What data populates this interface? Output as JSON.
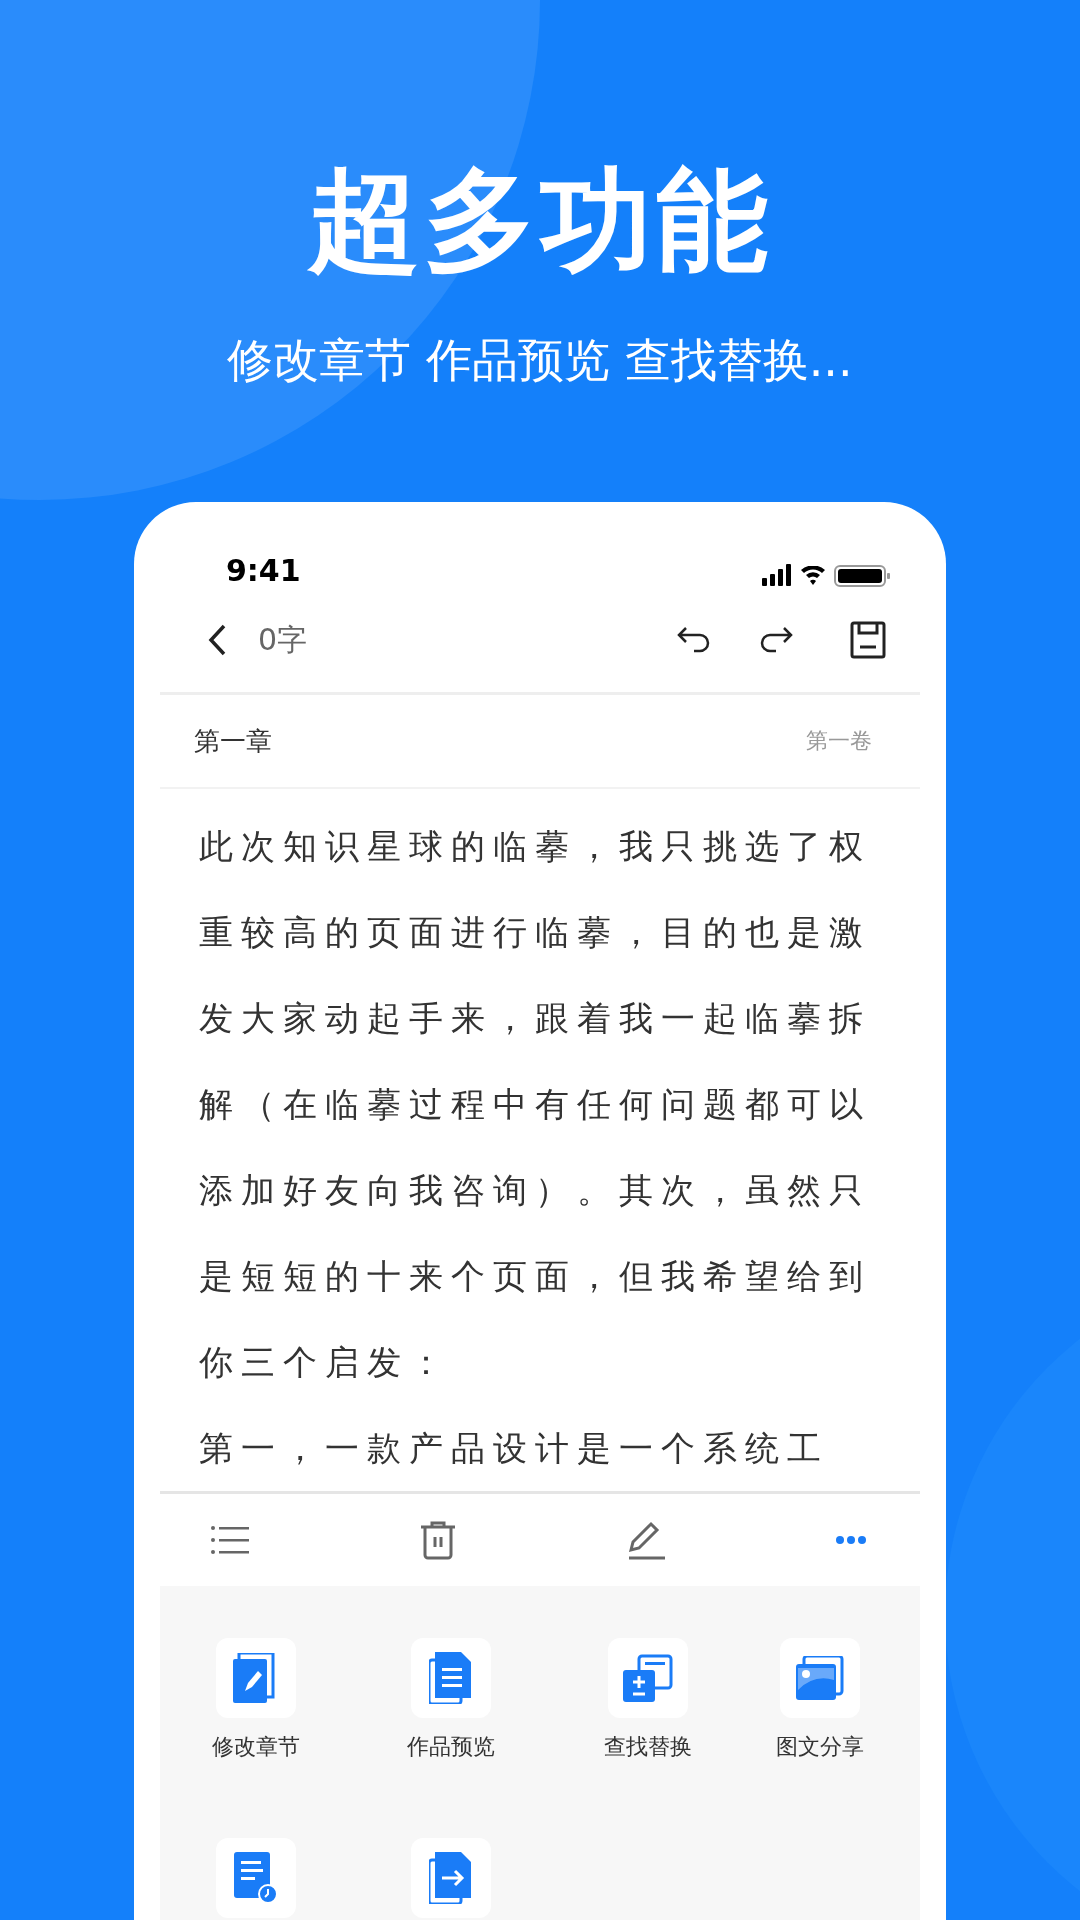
{
  "promo": {
    "headline": "超多功能",
    "subtitle": "修改章节 作品预览 查找替换..."
  },
  "status_bar": {
    "time": "9:41"
  },
  "nav_bar": {
    "word_count": "0字"
  },
  "chapter": {
    "title": "第一章",
    "volume": "第一卷"
  },
  "body_lines": [
    "此次知识星球的临摹，我只挑选了权",
    "重较高的页面进行临摹，目的也是激",
    "发大家动起手来，跟着我一起临摹拆",
    "解（在临摹过程中有任何问题都可以",
    "添加好友向我咨询）。其次，虽然只",
    "是短短的十来个页面，但我希望给到",
    "你三个启发：",
    "第一，一款产品设计是一个系统工"
  ],
  "tools": [
    {
      "kind": "tool",
      "label": "修改章节"
    },
    {
      "kind": "tool",
      "label": "作品预览"
    },
    {
      "kind": "tool",
      "label": "查找替换"
    },
    {
      "kind": "tool",
      "label": "图文分享"
    },
    {
      "kind": "tool"
    },
    {
      "kind": "tool"
    }
  ]
}
